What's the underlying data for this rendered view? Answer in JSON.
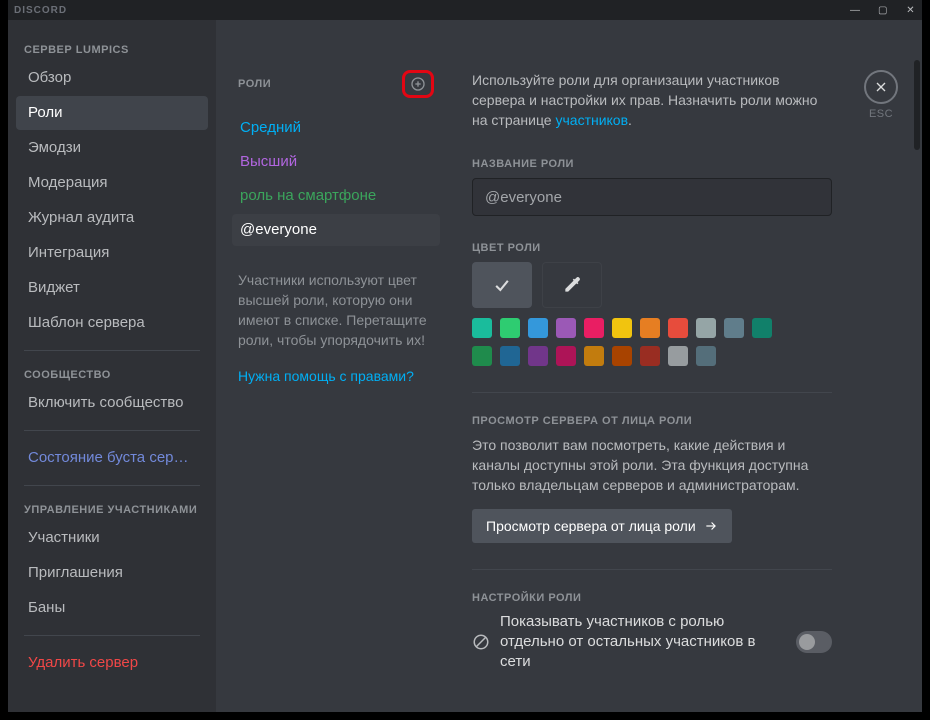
{
  "window": {
    "brand": "DISCORD"
  },
  "sidebar": {
    "section_server": "СЕРВЕР LUMPICS",
    "items": [
      {
        "label": "Обзор"
      },
      {
        "label": "Роли",
        "active": true
      },
      {
        "label": "Эмодзи"
      },
      {
        "label": "Модерация"
      },
      {
        "label": "Журнал аудита"
      },
      {
        "label": "Интеграция"
      },
      {
        "label": "Виджет"
      },
      {
        "label": "Шаблон сервера"
      }
    ],
    "section_community": "СООБЩЕСТВО",
    "community": [
      {
        "label": "Включить сообщество"
      }
    ],
    "boost": {
      "label": "Состояние буста серв…"
    },
    "section_members": "УПРАВЛЕНИЕ УЧАСТНИКАМИ",
    "members": [
      {
        "label": "Участники"
      },
      {
        "label": "Приглашения"
      },
      {
        "label": "Баны"
      }
    ],
    "delete": {
      "label": "Удалить сервер"
    }
  },
  "roles": {
    "header": "РОЛИ",
    "items": [
      {
        "label": "Средний",
        "color": "#00aff4"
      },
      {
        "label": "Высший",
        "color": "#b266e0"
      },
      {
        "label": "роль на смартфоне",
        "color": "#3ba55c"
      },
      {
        "label": "@everyone",
        "color": "#ffffff",
        "selected": true
      }
    ],
    "help_text": "Участники используют цвет высшей роли, которую они имеют в списке. Перетащите роли, чтобы упорядочить их!",
    "help_link": "Нужна помощь с правами?"
  },
  "main": {
    "intro_pre": "Используйте роли для организации участников сервера и настройки их прав. Назначить роли можно на странице ",
    "intro_link": "участников",
    "intro_post": ".",
    "esc_label": "ESC",
    "name": {
      "label": "НАЗВАНИЕ РОЛИ",
      "value": "@everyone"
    },
    "color": {
      "label": "ЦВЕТ РОЛИ",
      "default": "#4f545c",
      "swatches": [
        "#1abc9c",
        "#2ecc71",
        "#3498db",
        "#9b59b6",
        "#e91e63",
        "#f1c40f",
        "#e67e22",
        "#e74c3c",
        "#95a5a6",
        "#607d8b",
        "#11806a",
        "#1f8b4c",
        "#206694",
        "#71368a",
        "#ad1457",
        "#c27c0e",
        "#a84300",
        "#992d22",
        "#979c9f",
        "#546e7a"
      ]
    },
    "preview": {
      "label": "ПРОСМОТР СЕРВЕРА ОТ ЛИЦА РОЛИ",
      "desc": "Это позволит вам посмотреть, какие действия и каналы доступны этой роли. Эта функция доступна только владельцам серверов и администраторам.",
      "button": "Просмотр сервера от лица роли"
    },
    "perms": {
      "label": "НАСТРОЙКИ РОЛИ",
      "show_separately": "Показывать участников с ролью отдельно от остальных участников в сети"
    }
  }
}
